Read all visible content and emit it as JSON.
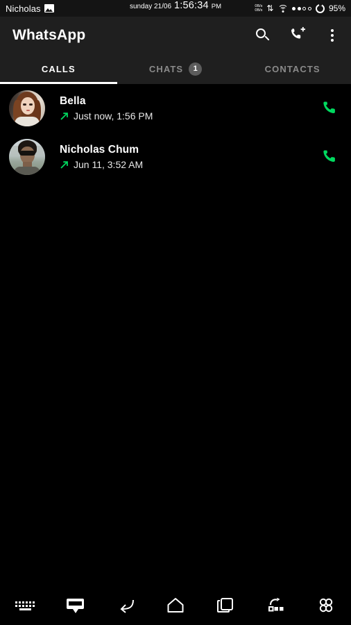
{
  "statusbar": {
    "user": "Nicholas",
    "gallery_icon": "image-icon",
    "date": "sunday 21/06",
    "time": "1:56:34",
    "ampm": "PM",
    "net_up": "0B/s",
    "net_down": "0B/s",
    "updown_icon": "data-transfer-icon",
    "wifi_icon": "wifi-icon",
    "signal_icon": "signal-dots-icon",
    "battery_icon": "battery-ring-icon",
    "battery": "95%"
  },
  "toolbar": {
    "title": "WhatsApp",
    "search_icon": "search-icon",
    "new_call_icon": "new-call-icon",
    "overflow_icon": "overflow-menu-icon"
  },
  "tabs": [
    {
      "label": "CALLS",
      "active": true,
      "badge": ""
    },
    {
      "label": "CHATS",
      "active": false,
      "badge": "1"
    },
    {
      "label": "CONTACTS",
      "active": false,
      "badge": ""
    }
  ],
  "calls": [
    {
      "name": "Bella",
      "direction_icon": "outgoing-call-arrow",
      "detail": "Just now, 1:56 PM",
      "action_icon": "call-button-icon"
    },
    {
      "name": "Nicholas Chum",
      "direction_icon": "outgoing-call-arrow",
      "detail": "Jun 11, 3:52 AM",
      "action_icon": "call-button-icon"
    }
  ],
  "navbar": [
    {
      "icon": "keyboard-icon"
    },
    {
      "icon": "message-box-icon"
    },
    {
      "icon": "back-icon"
    },
    {
      "icon": "home-icon"
    },
    {
      "icon": "recent-apps-icon"
    },
    {
      "icon": "screenshot-rotate-icon"
    },
    {
      "icon": "apps-grid-icon"
    }
  ],
  "colors": {
    "accent_green": "#00d95f",
    "toolbar_bg": "#1f1f1f",
    "body_bg": "#000000",
    "badge_bg": "#5c5c5c",
    "inactive_tab": "#8a8a8a"
  }
}
